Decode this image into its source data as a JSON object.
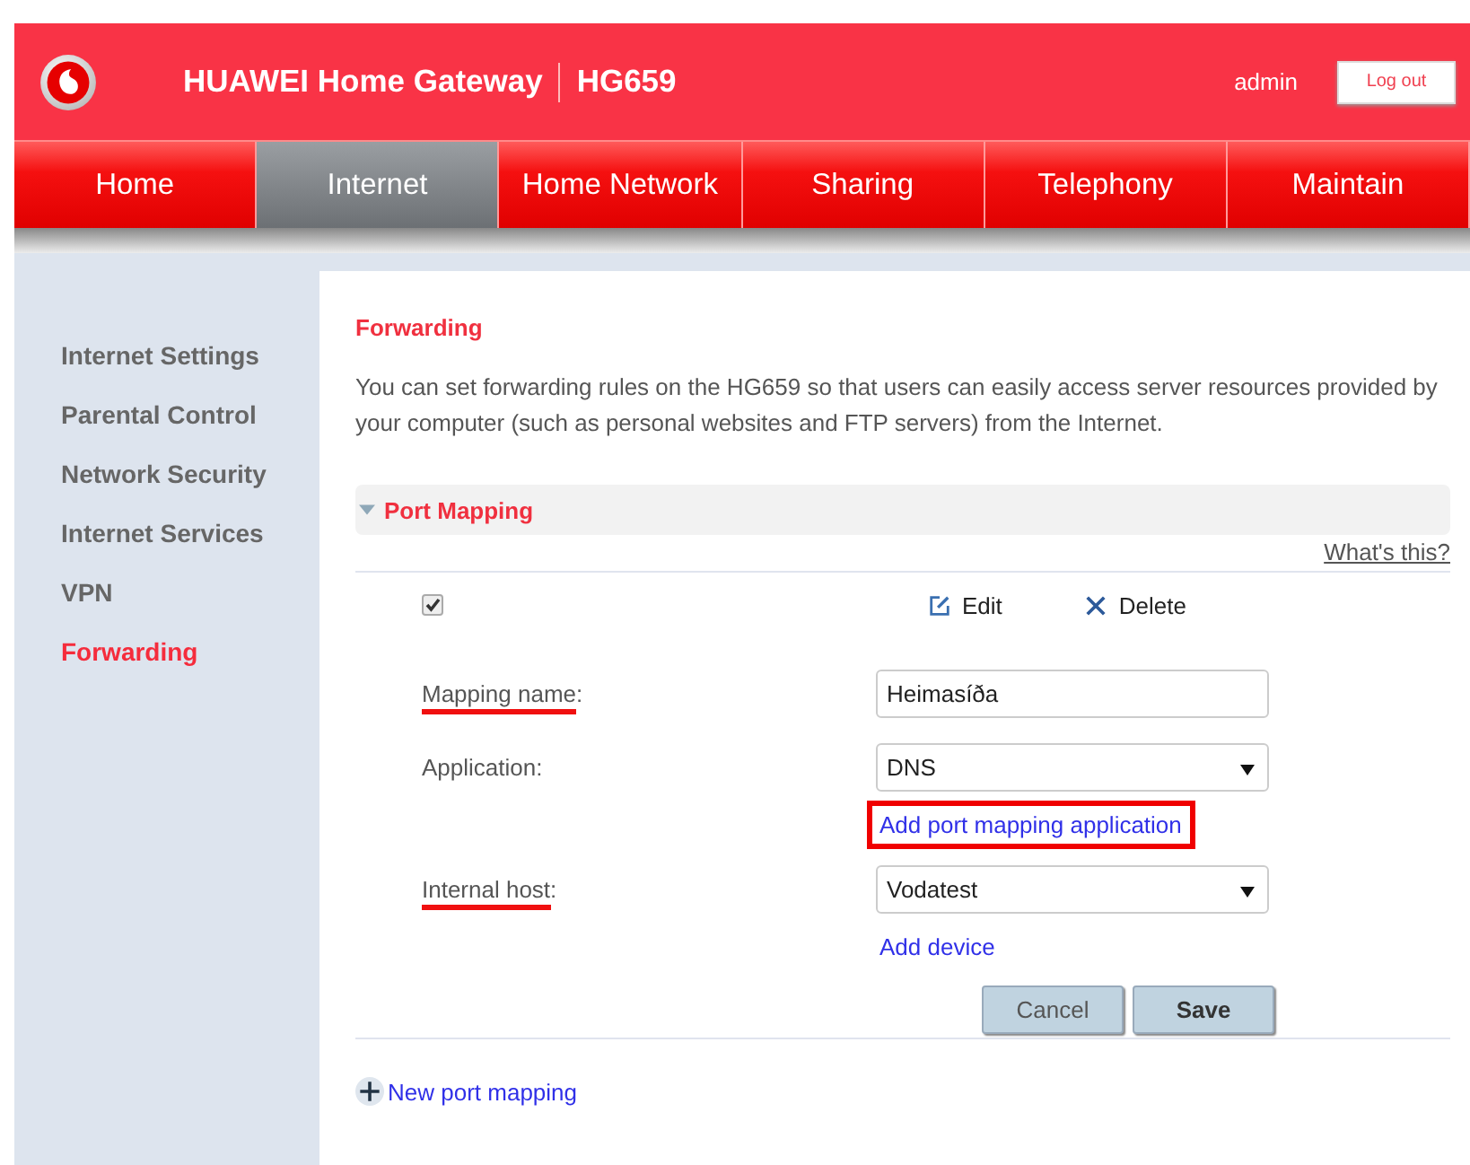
{
  "header": {
    "brand": "HUAWEI Home Gateway",
    "model": "HG659",
    "user": "admin",
    "logout": "Log out"
  },
  "tabs": [
    {
      "label": "Home",
      "selected": false
    },
    {
      "label": "Internet",
      "selected": true
    },
    {
      "label": "Home Network",
      "selected": false
    },
    {
      "label": "Sharing",
      "selected": false
    },
    {
      "label": "Telephony",
      "selected": false
    },
    {
      "label": "Maintain",
      "selected": false
    }
  ],
  "sidebar": {
    "items": [
      {
        "label": "Internet Settings",
        "selected": false
      },
      {
        "label": "Parental Control",
        "selected": false
      },
      {
        "label": "Network Security",
        "selected": false
      },
      {
        "label": "Internet Services",
        "selected": false
      },
      {
        "label": "VPN",
        "selected": false
      },
      {
        "label": "Forwarding",
        "selected": true
      }
    ]
  },
  "content": {
    "title": "Forwarding",
    "description": "You can set forwarding rules on the HG659 so that users can easily access server resources provided by your computer (such as personal websites and FTP servers) from the Internet.",
    "section": {
      "title": "Port Mapping",
      "expanded": true,
      "help": "What's this?"
    },
    "row": {
      "checked": true,
      "actions": [
        {
          "kind": "edit",
          "label": "Edit"
        },
        {
          "kind": "delete",
          "label": "Delete"
        }
      ]
    },
    "fields": [
      {
        "kind": "text",
        "label": "Mapping name",
        "colon": ":",
        "highlighted": true,
        "value": "Heimasíða"
      },
      {
        "kind": "select",
        "label": "Application",
        "colon": ":",
        "highlighted": false,
        "value": "DNS",
        "link": {
          "text": "Add port mapping application",
          "highlighted": true
        }
      },
      {
        "kind": "select",
        "label": "Internal host",
        "colon": ":",
        "highlighted": true,
        "value": "Vodatest",
        "link": {
          "text": "Add device",
          "highlighted": false
        }
      }
    ],
    "buttons": [
      {
        "kind": "cancel",
        "label": "Cancel"
      },
      {
        "kind": "save",
        "label": "Save"
      }
    ],
    "new_link": "New port mapping"
  }
}
